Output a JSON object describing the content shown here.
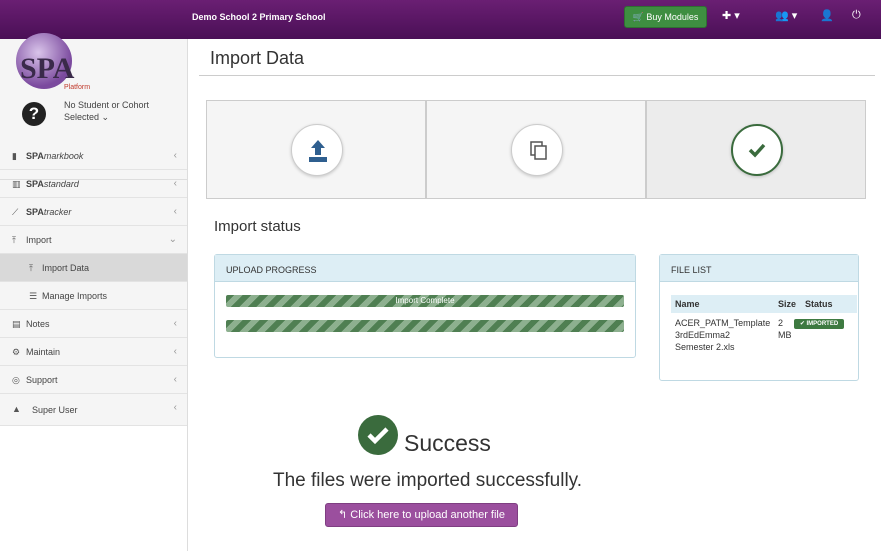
{
  "header": {
    "school_name": "Demo School 2 Primary School",
    "buy_modules_label": "Buy Modules"
  },
  "brand": {
    "logo_text": "SPA",
    "logo_subtext": "Platform"
  },
  "sidebar": {
    "user_line1": "No Student or Cohort",
    "user_line2": "Selected",
    "items": [
      {
        "prefix": "SPA",
        "suffix": "markbook"
      },
      {
        "prefix": "SPA",
        "suffix": "standard"
      },
      {
        "prefix": "SPA",
        "suffix": "tracker"
      },
      {
        "label": "Import"
      },
      {
        "label": "Import Data"
      },
      {
        "label": "Manage Imports"
      },
      {
        "label": "Notes"
      },
      {
        "label": "Maintain"
      },
      {
        "label": "Support"
      },
      {
        "label": "Super User"
      }
    ]
  },
  "main": {
    "page_title": "Import Data",
    "section_title": "Import status",
    "upload_panel_title": "UPLOAD PROGRESS",
    "progress_bar_1_label": "Import Complete",
    "progress_bar_1_pct": 100,
    "progress_bar_2_pct": 100,
    "file_list_title": "FILE LIST",
    "file_list_headers": [
      "Name",
      "Size",
      "Status"
    ],
    "file": {
      "name_line1": "ACER_PATM_Template",
      "name_line2": "3rdEdEmma2",
      "name_line3": "Semester 2.xls",
      "size_line1": "2",
      "size_line2": "MB",
      "status": "IMPORTED"
    },
    "success_title": "Success",
    "success_message": "The files were imported successfully.",
    "upload_another_label": "Click here to upload another file"
  },
  "colors": {
    "topbar": "#5b1766",
    "buy_button": "#3e8e41",
    "success": "#3a6b3d",
    "upload_button": "#9b4f9e",
    "panel_head": "#ddeef5"
  }
}
